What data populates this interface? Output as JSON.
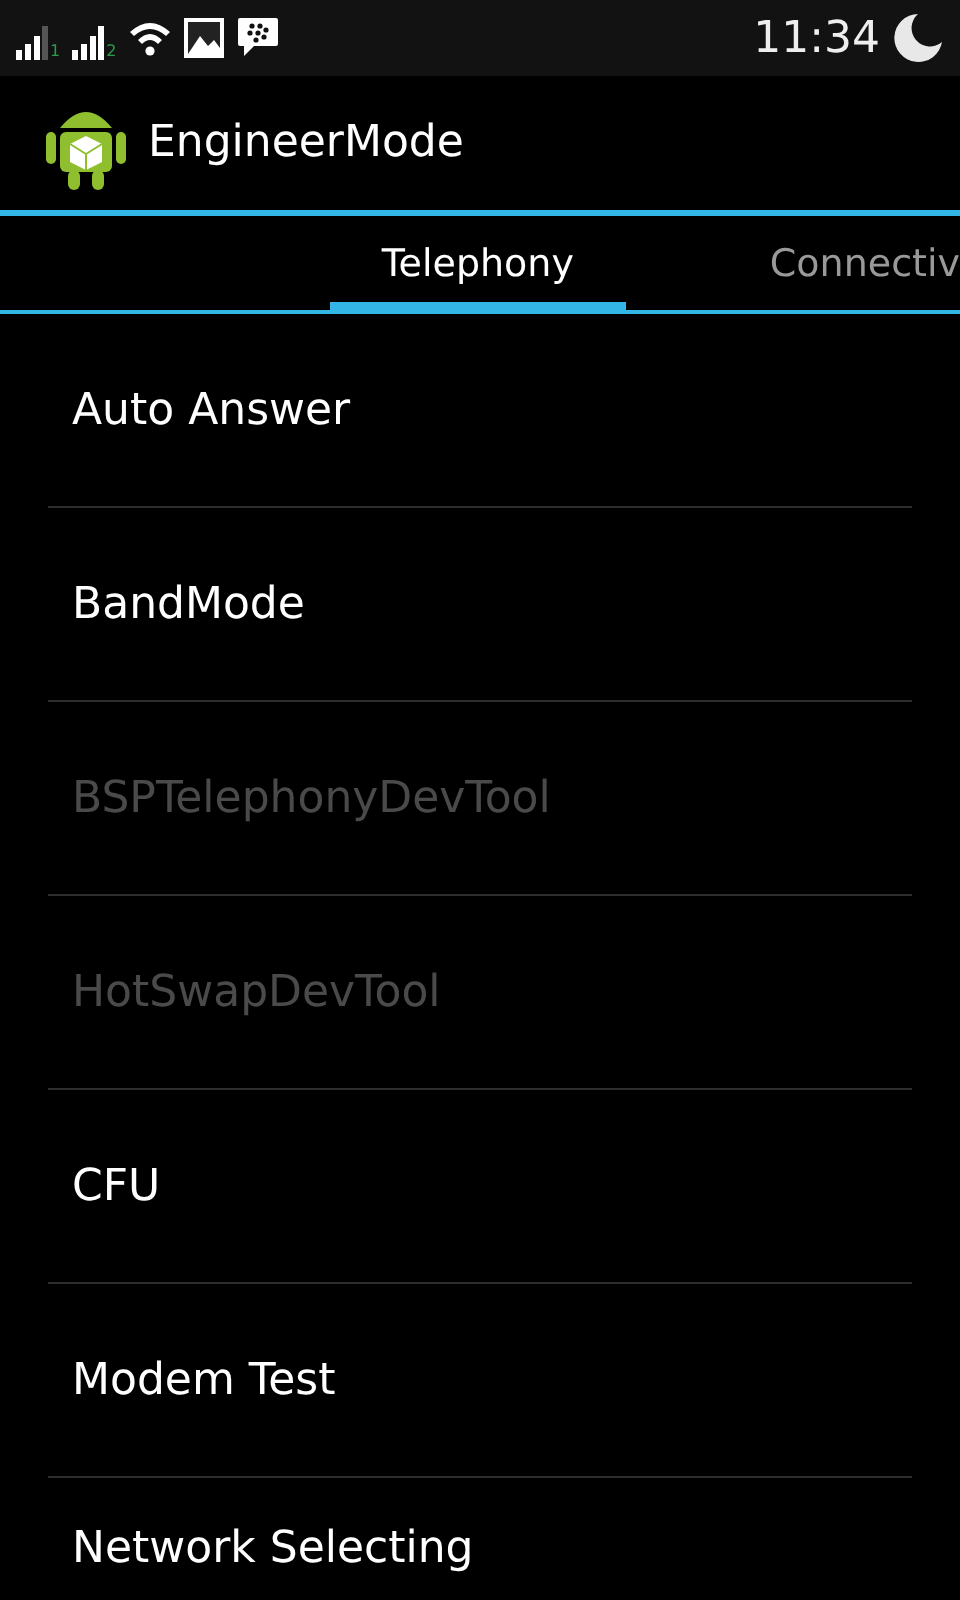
{
  "status_bar": {
    "sim_labels": [
      "1",
      "2"
    ],
    "time": "11:34"
  },
  "action_bar": {
    "title": "EngineerMode"
  },
  "tabs": [
    {
      "label": "Telephony",
      "selected": true
    },
    {
      "label": "Connectiv",
      "selected": false
    }
  ],
  "items": [
    {
      "label": "Auto Answer",
      "disabled": false
    },
    {
      "label": "BandMode",
      "disabled": false
    },
    {
      "label": "BSPTelephonyDevTool",
      "disabled": true
    },
    {
      "label": "HotSwapDevTool",
      "disabled": true
    },
    {
      "label": "CFU",
      "disabled": false
    },
    {
      "label": "Modem Test",
      "disabled": false
    },
    {
      "label": "Network Selecting",
      "disabled": false
    }
  ]
}
